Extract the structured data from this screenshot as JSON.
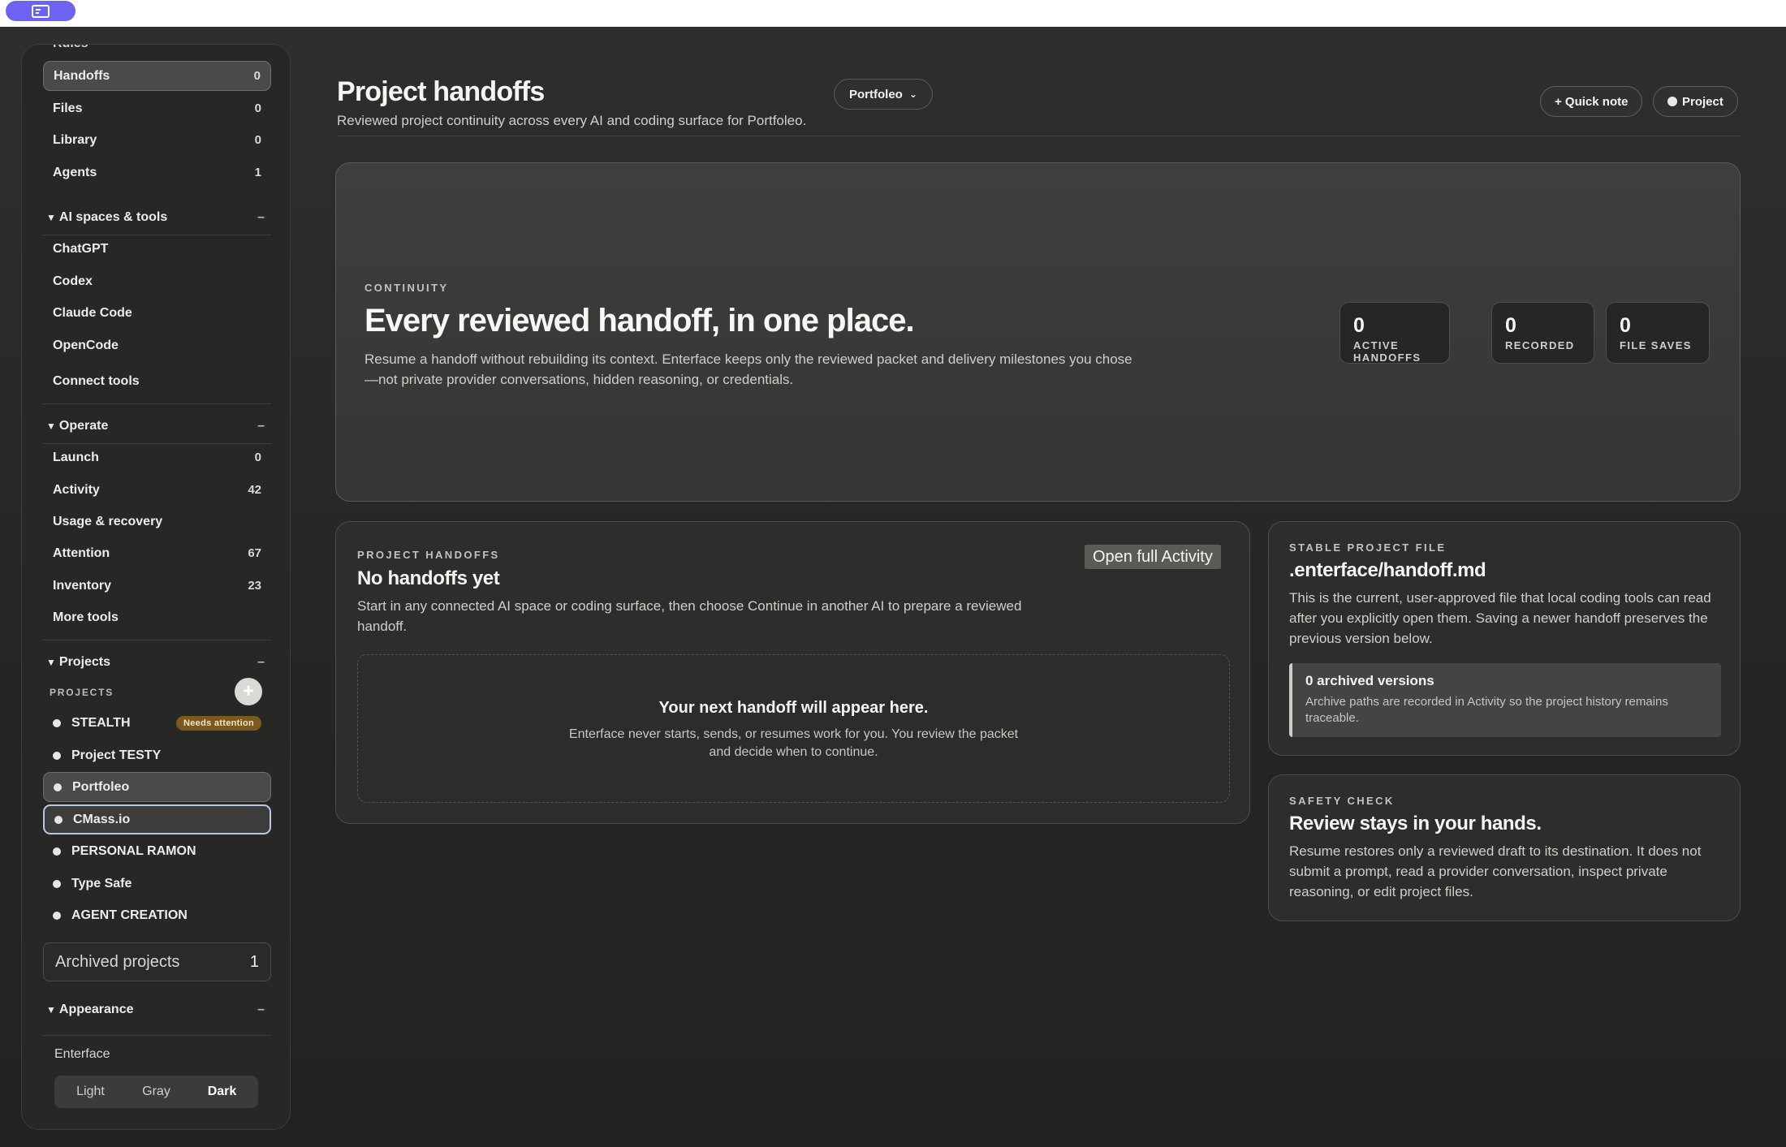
{
  "topbar": {
    "icon": "app-window-icon",
    "accent": "#6c63f2"
  },
  "sidebar": {
    "cut_item": "Rules",
    "nav": [
      {
        "label": "Handoffs",
        "count": "0"
      },
      {
        "label": "Files",
        "count": "0"
      },
      {
        "label": "Library",
        "count": "0"
      },
      {
        "label": "Agents",
        "count": "1"
      }
    ],
    "ai_section": {
      "title": "AI spaces & tools",
      "collapse": "–",
      "items": [
        "ChatGPT",
        "Codex",
        "Claude Code",
        "OpenCode"
      ],
      "connect": "Connect tools"
    },
    "operate_section": {
      "title": "Operate",
      "collapse": "–",
      "items": [
        {
          "label": "Launch",
          "count": "0"
        },
        {
          "label": "Activity",
          "count": "42"
        },
        {
          "label": "Usage & recovery",
          "count": ""
        },
        {
          "label": "Attention",
          "count": "67"
        },
        {
          "label": "Inventory",
          "count": "23"
        },
        {
          "label": "More tools",
          "count": ""
        }
      ]
    },
    "projects_section": {
      "title": "Projects",
      "collapse": "–",
      "sublabel": "PROJECTS",
      "add": "+",
      "items": [
        {
          "label": "STEALTH",
          "badge": "Needs attention"
        },
        {
          "label": "Project TESTY"
        },
        {
          "label": "Portfoleo"
        },
        {
          "label": "CMass.io"
        },
        {
          "label": "PERSONAL RAMON"
        },
        {
          "label": "Type Safe"
        },
        {
          "label": "AGENT CREATION"
        }
      ],
      "archived_label": "Archived projects",
      "archived_count": "1"
    },
    "appearance_section": {
      "title": "Appearance",
      "collapse": "–",
      "theme_name": "Enterface",
      "options": [
        "Light",
        "Gray",
        "Dark"
      ],
      "selected": "Dark"
    }
  },
  "header": {
    "title": "Project handoffs",
    "subtitle": "Reviewed project continuity across every AI and coding surface for Portfoleo.",
    "project_select": "Portfoleo",
    "quick_note": "+ Quick note",
    "project_button": "Project"
  },
  "hero": {
    "eyebrow": "CONTINUITY",
    "title": "Every reviewed handoff, in one place.",
    "body": "Resume a handoff without rebuilding its context. Enterface keeps only the reviewed packet and delivery milestones you chose—not private provider conversations, hidden reasoning, or credentials.",
    "stats": [
      {
        "value": "0",
        "label": "ACTIVE HANDOFFS"
      },
      {
        "value": "0",
        "label": "RECORDED"
      },
      {
        "value": "0",
        "label": "FILE SAVES"
      }
    ]
  },
  "handoffs_card": {
    "eyebrow": "PROJECT HANDOFFS",
    "title": "No handoffs yet",
    "body": "Start in any connected AI space or coding surface, then choose Continue in another AI to prepare a reviewed handoff.",
    "open_activity": "Open full Activity",
    "empty_title": "Your next handoff will appear here.",
    "empty_body": "Enterface never starts, sends, or resumes work for you. You review the packet and decide when to continue."
  },
  "stable_card": {
    "eyebrow": "STABLE PROJECT FILE",
    "title": ".enterface/handoff.md",
    "body": "This is the current, user-approved file that local coding tools can read after you explicitly open them. Saving a newer handoff preserves the previous version below.",
    "note_title": "0 archived versions",
    "note_body": "Archive paths are recorded in Activity so the project history remains traceable."
  },
  "safety_card": {
    "eyebrow": "SAFETY CHECK",
    "title": "Review stays in your hands.",
    "body": "Resume restores only a reviewed draft to its destination. It does not submit a prompt, read a provider conversation, inspect private reasoning, or edit project files."
  }
}
